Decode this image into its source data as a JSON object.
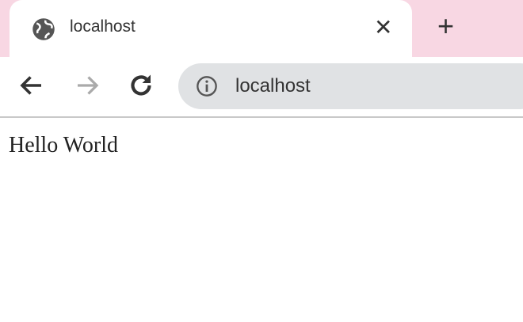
{
  "tab": {
    "title": "localhost",
    "favicon": "globe-icon"
  },
  "omnibox": {
    "url": "localhost"
  },
  "page": {
    "text": "Hello World"
  }
}
